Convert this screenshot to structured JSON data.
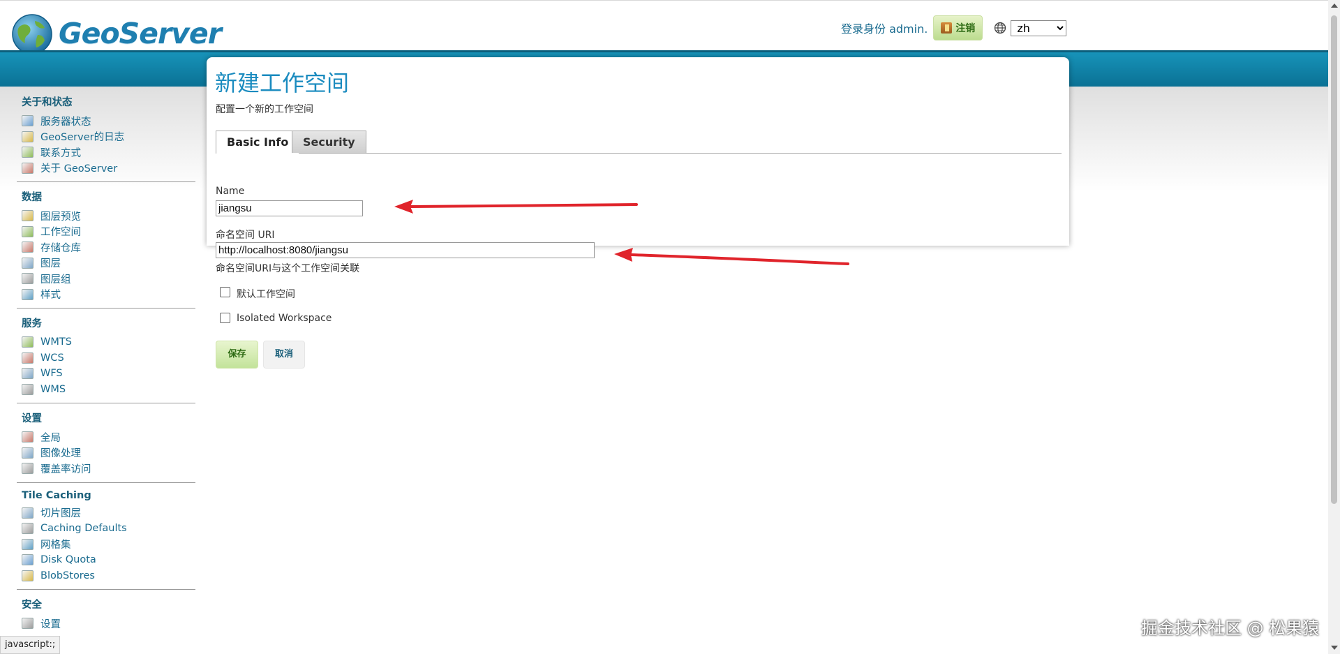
{
  "header": {
    "logo_text": "GeoServer",
    "login_text": "登录身份 admin.",
    "logout_label": "注销",
    "language_value": "zh"
  },
  "sidebar": {
    "sections": [
      {
        "title": "关于和状态",
        "items": [
          {
            "label": "服务器状态",
            "icon": "server-status-icon"
          },
          {
            "label": "GeoServer的日志",
            "icon": "log-icon"
          },
          {
            "label": "联系方式",
            "icon": "contact-icon"
          },
          {
            "label": "关于 GeoServer",
            "icon": "about-icon"
          }
        ]
      },
      {
        "title": "数据",
        "items": [
          {
            "label": "图层预览",
            "icon": "layer-preview-icon"
          },
          {
            "label": "工作空间",
            "icon": "workspace-folder-icon"
          },
          {
            "label": "存储仓库",
            "icon": "store-icon"
          },
          {
            "label": "图层",
            "icon": "layer-icon"
          },
          {
            "label": "图层组",
            "icon": "layer-group-icon"
          },
          {
            "label": "样式",
            "icon": "style-palette-icon"
          }
        ]
      },
      {
        "title": "服务",
        "items": [
          {
            "label": "WMTS",
            "icon": "wmts-icon"
          },
          {
            "label": "WCS",
            "icon": "wcs-icon"
          },
          {
            "label": "WFS",
            "icon": "wfs-icon"
          },
          {
            "label": "WMS",
            "icon": "wms-icon"
          }
        ]
      },
      {
        "title": "设置",
        "items": [
          {
            "label": "全局",
            "icon": "global-settings-icon"
          },
          {
            "label": "图像处理",
            "icon": "image-processing-icon"
          },
          {
            "label": "覆盖率访问",
            "icon": "coverage-access-icon"
          }
        ]
      },
      {
        "title": "Tile Caching",
        "items": [
          {
            "label": "切片图层",
            "icon": "tile-layers-icon"
          },
          {
            "label": "Caching Defaults",
            "icon": "caching-defaults-icon"
          },
          {
            "label": "网格集",
            "icon": "gridsets-icon"
          },
          {
            "label": "Disk Quota",
            "icon": "disk-quota-icon"
          },
          {
            "label": "BlobStores",
            "icon": "blobstores-icon"
          }
        ]
      },
      {
        "title": "安全",
        "items": [
          {
            "label": "设置",
            "icon": "security-settings-wrench-icon"
          }
        ]
      }
    ]
  },
  "main": {
    "title": "新建工作空间",
    "description": "配置一个新的工作空间",
    "tabs": [
      "Basic Info",
      "Security"
    ],
    "name_label": "Name",
    "name_value": "jiangsu",
    "uri_label": "命名空间 URI",
    "uri_value": "http://localhost:8080/jiangsu",
    "uri_hint": "命名空间URI与这个工作空间关联",
    "default_workspace_label": "默认工作空间",
    "default_workspace_checked": false,
    "isolated_workspace_label": "Isolated Workspace",
    "isolated_workspace_checked": false,
    "save_label": "保存",
    "cancel_label": "取消"
  },
  "status_bar": "javascript:;",
  "watermark": "掘金技术社区 @ 松果猿",
  "colors": {
    "accent": "#1a8bbf",
    "band": "#1793b9",
    "link": "#1a6b8f",
    "arrow": "#e0242b"
  }
}
